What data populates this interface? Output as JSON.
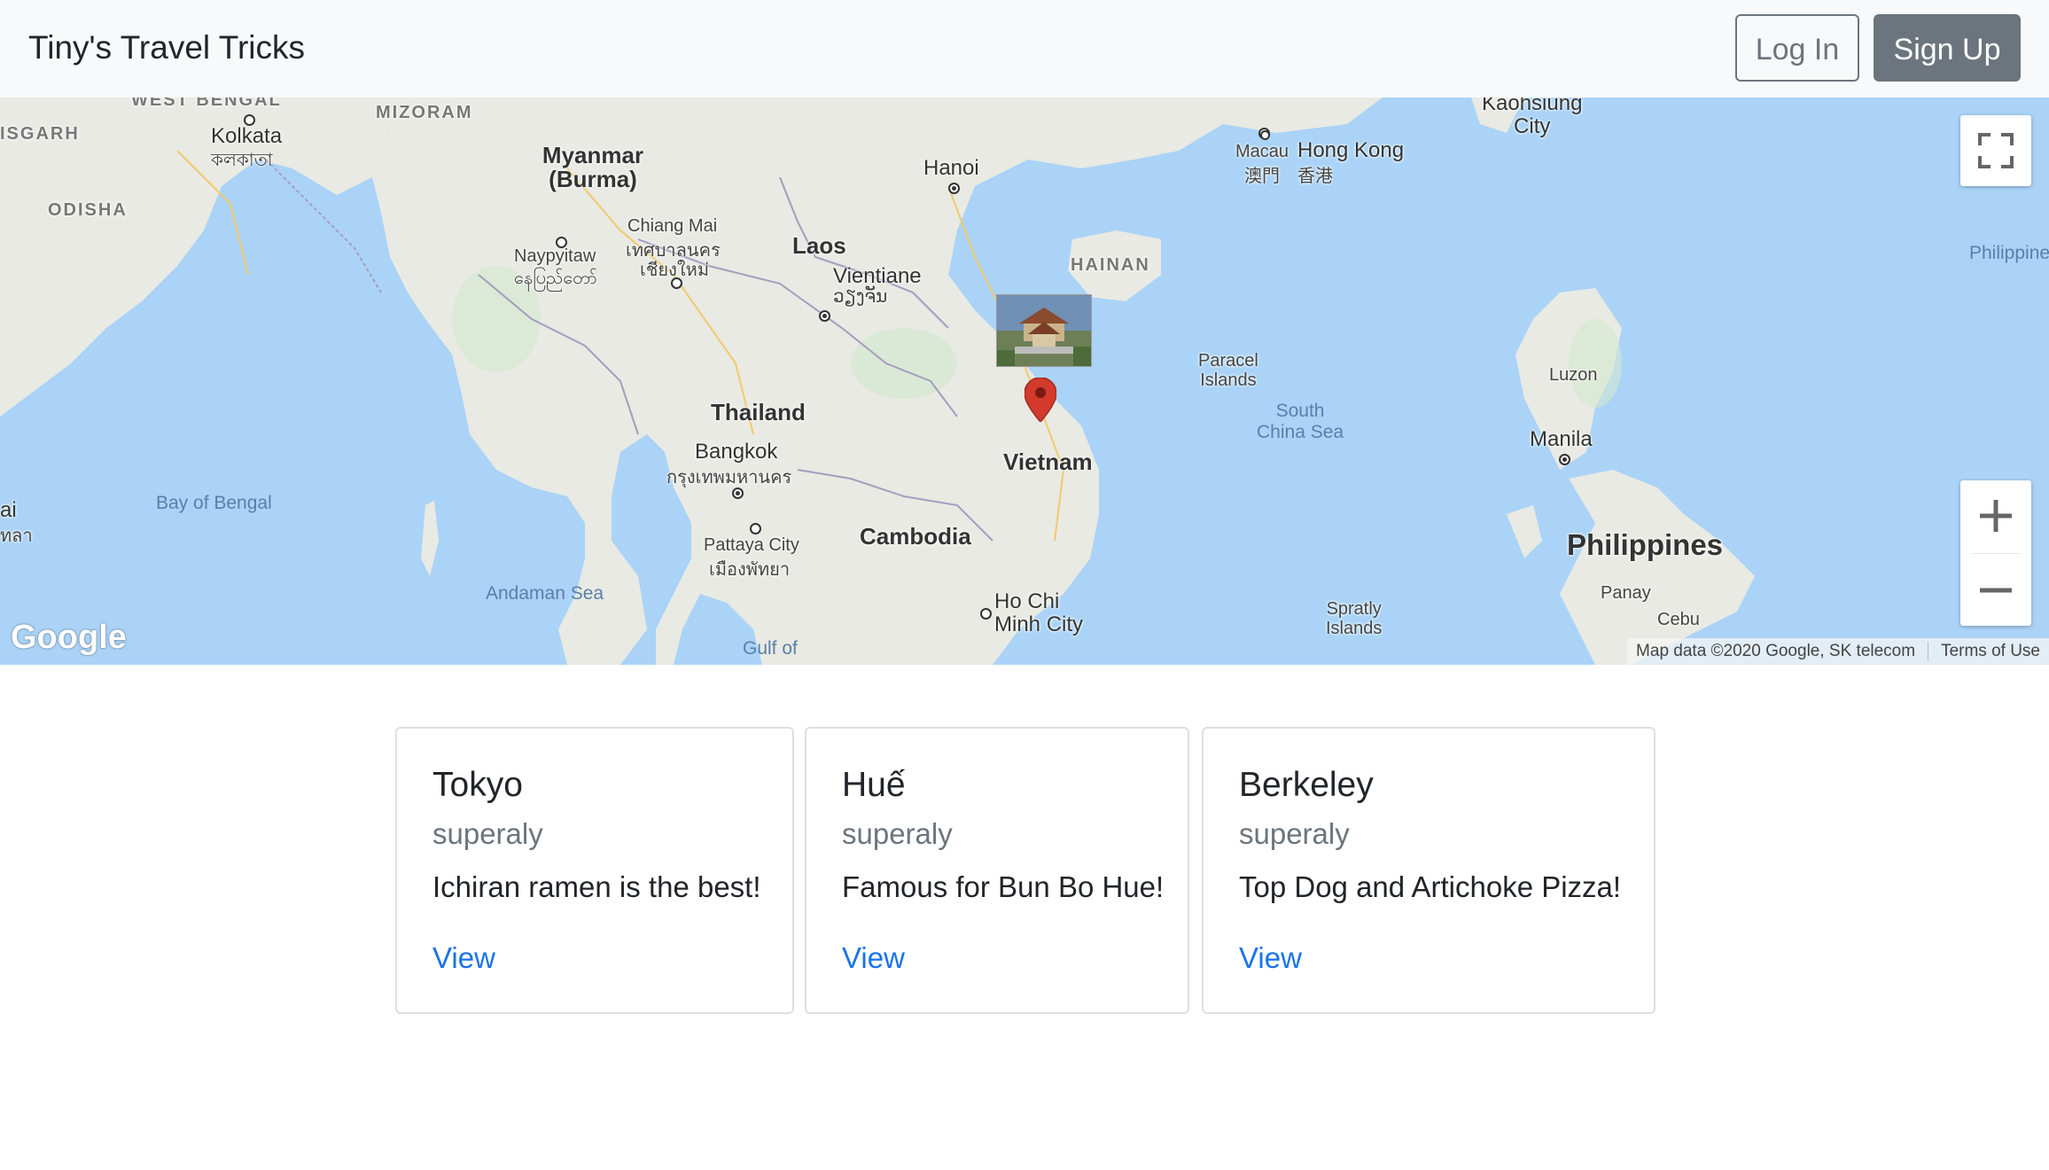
{
  "navbar": {
    "brand": "Tiny's Travel Tricks",
    "login_label": "Log In",
    "signup_label": "Sign Up"
  },
  "map": {
    "labels": {
      "west_bengal": "WEST BENGAL",
      "isgarh": "ISGARH",
      "kolkata": "Kolkata",
      "kolkata_local": "কলকাতা",
      "mizoram": "MIZORAM",
      "myanmar": "Myanmar\n(Burma)",
      "odisha": "ODISHA",
      "naypyitaw": "Naypyitaw",
      "naypyitaw_local": "နေပြည်တော်",
      "chiang_mai": "Chiang Mai",
      "chiang_mai_local1": "เทศบาลนคร",
      "chiang_mai_local2": "เชียงใหม่",
      "laos": "Laos",
      "hanoi": "Hanoi",
      "vientiane": "Vientiane",
      "vientiane_local": "ວຽງຈັນ",
      "hainan": "HAINAN",
      "macau": "Macau",
      "macau_local": "澳門",
      "hong_kong": "Hong Kong",
      "hong_kong_local": "香港",
      "kaohsiung": "Kaohsiung\nCity",
      "philippine_sea": "Philippine",
      "thailand": "Thailand",
      "bangkok": "Bangkok",
      "bangkok_local": "กรุงเทพมหานคร",
      "vietnam": "Vietnam",
      "paracel": "Paracel\nIslands",
      "south_china_sea": "South\nChina Sea",
      "luzon": "Luzon",
      "manila": "Manila",
      "bay_of_bengal": "Bay of Bengal",
      "pattaya": "Pattaya City",
      "pattaya_local": "เมืองพัทยา",
      "cambodia": "Cambodia",
      "philippines": "Philippines",
      "andaman_sea": "Andaman Sea",
      "ho_chi_minh": "Ho Chi\nMinh City",
      "spratly": "Spratly\nIslands",
      "panay": "Panay",
      "cebu": "Cebu",
      "gulf_of": "Gulf of",
      "ai": "ai",
      "tha": "ทลา"
    },
    "google_logo": "Google",
    "attribution": "Map data ©2020 Google, SK telecom",
    "terms": "Terms of Use",
    "colors": {
      "water": "#aad3f7",
      "land": "#e8eae3",
      "pin": "#d33a2c"
    }
  },
  "cards": [
    {
      "title": "Tokyo",
      "author": "superaly",
      "text": "Ichiran ramen is the best!",
      "link": "View"
    },
    {
      "title": "Huế",
      "author": "superaly",
      "text": "Famous for Bun Bo Hue!",
      "link": "View"
    },
    {
      "title": "Berkeley",
      "author": "superaly",
      "text": "Top Dog and Artichoke Pizza!",
      "link": "View"
    }
  ]
}
